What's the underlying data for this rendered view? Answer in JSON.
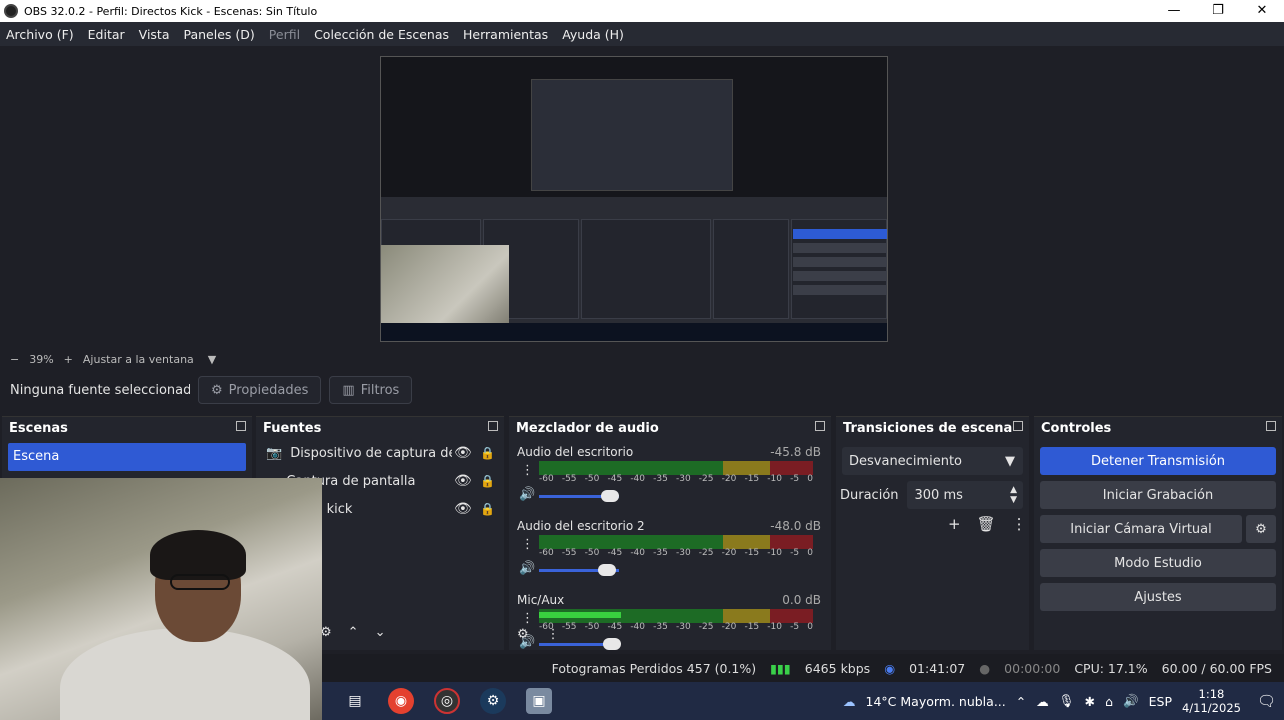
{
  "window": {
    "title": "OBS 32.0.2 - Perfil: Directos Kick - Escenas: Sin Título",
    "controls": [
      "—",
      "❐",
      "✕"
    ]
  },
  "menu": [
    "Archivo (F)",
    "Editar",
    "Vista",
    "Paneles (D)",
    "Perfil",
    "Colección de Escenas",
    "Herramientas",
    "Ayuda (H)"
  ],
  "zoom": {
    "minus": "−",
    "level": "39%",
    "plus": "+",
    "fit": "Ajustar a la ventana"
  },
  "source_toolbar": {
    "no_selection": "Ninguna fuente seleccionada",
    "properties": "Propiedades",
    "filters": "Filtros"
  },
  "scenes": {
    "title": "Escenas",
    "items": [
      "Escena"
    ]
  },
  "sources": {
    "title": "Fuentes",
    "items": [
      {
        "label": "Dispositivo de captura de vídeo"
      },
      {
        "label": "Captura de pantalla"
      },
      {
        "label": "Chats kick"
      }
    ]
  },
  "mixer": {
    "title": "Mezclador de audio",
    "ticks": [
      "-60",
      "-55",
      "-50",
      "-45",
      "-40",
      "-35",
      "-30",
      "-25",
      "-20",
      "-15",
      "-10",
      "-5",
      "0"
    ],
    "channels": [
      {
        "name": "Audio del escritorio",
        "db": "-45.8 dB",
        "level": 0.0,
        "volume": 0.78
      },
      {
        "name": "Audio del escritorio 2",
        "db": "-48.0 dB",
        "level": 0.0,
        "volume": 0.74
      },
      {
        "name": "Mic/Aux",
        "db": "0.0 dB",
        "level": 0.3,
        "volume": 0.8
      }
    ]
  },
  "transitions": {
    "title": "Transiciones de escena",
    "type": "Desvanecimiento",
    "duration_label": "Duración",
    "duration": "300 ms"
  },
  "controls": {
    "title": "Controles",
    "stop_stream": "Detener Transmisión",
    "start_record": "Iniciar Grabación",
    "start_virtual_cam": "Iniciar Cámara Virtual",
    "studio_mode": "Modo Estudio",
    "settings": "Ajustes"
  },
  "status": {
    "dropped": "Fotogramas Perdidos 457 (0.1%)",
    "bitrate": "6465 kbps",
    "stream_time": "01:41:07",
    "rec_time": "00:00:00",
    "cpu": "CPU: 17.1%",
    "fps": "60.00 / 60.00 FPS"
  },
  "taskbar": {
    "weather": "14°C  Mayorm. nubla...",
    "lang": "ESP",
    "time": "1:18",
    "date": "4/11/2025"
  },
  "colors": {
    "accent": "#2f5ad4",
    "panel": "#23252d",
    "background": "#1e1f26"
  }
}
